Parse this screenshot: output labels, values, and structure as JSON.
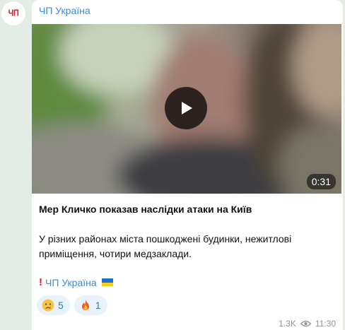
{
  "channel": {
    "avatar_text": "ЧП",
    "name": "ЧП Україна"
  },
  "video": {
    "duration": "0:31"
  },
  "post": {
    "title": "Мер Кличко показав наслідки атаки на Київ",
    "body": "У різних районах міста пошкоджені будинки, нежитлові приміщення, чотири медзаклади.",
    "signature_link": "ЧП Україна"
  },
  "reactions": [
    {
      "icon": "crying-face-icon",
      "count": "5"
    },
    {
      "icon": "fire-icon",
      "count": "1"
    }
  ],
  "meta": {
    "views": "1.3K",
    "time": "11:30"
  },
  "colors": {
    "background": "#e4ece6",
    "link": "#3a8bd8",
    "brand_red": "#d81e25",
    "reaction_bg": "#e9f2fb"
  }
}
